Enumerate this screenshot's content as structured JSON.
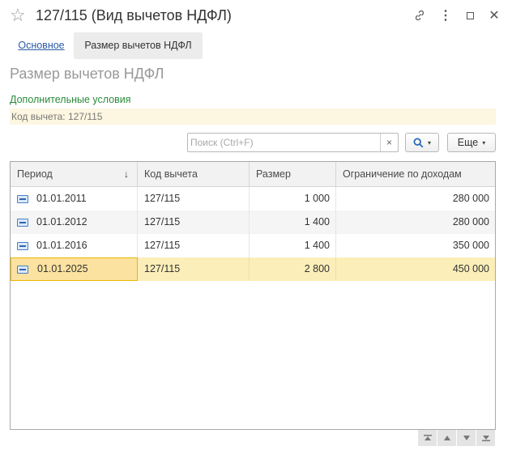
{
  "window": {
    "title": "127/115 (Вид вычетов НДФЛ)",
    "icons": [
      "star-icon",
      "link-icon",
      "more-vert-icon",
      "maximize-icon",
      "close-icon"
    ],
    "close_glyph": "✕",
    "more_glyph": "⋮"
  },
  "tabs": [
    {
      "label": "Основное",
      "active": false
    },
    {
      "label": "Размер вычетов НДФЛ",
      "active": true
    }
  ],
  "page": {
    "title": "Размер вычетов НДФЛ",
    "conditions_link": "Дополнительные условия",
    "filter_text": "Код вычета: 127/115"
  },
  "search": {
    "placeholder": "Поиск (Ctrl+F)",
    "value": "",
    "clear": "×"
  },
  "toolbar": {
    "more_label": "Еще",
    "caret": "▾"
  },
  "table": {
    "columns": [
      "Период",
      "Код вычета",
      "Размер",
      "Ограничение по доходам"
    ],
    "sort_indicator": "↓",
    "rows": [
      {
        "period": "01.01.2011",
        "code": "127/115",
        "size": "1 000",
        "limit": "280 000"
      },
      {
        "period": "01.01.2012",
        "code": "127/115",
        "size": "1 400",
        "limit": "280 000"
      },
      {
        "period": "01.01.2016",
        "code": "127/115",
        "size": "1 400",
        "limit": "350 000"
      },
      {
        "period": "01.01.2025",
        "code": "127/115",
        "size": "2 800",
        "limit": "450 000"
      }
    ],
    "selected_row": 3
  },
  "colors": {
    "link": "#2a5aa8",
    "green_link": "#2a8a3a",
    "selected_row": "#fbeeb8",
    "selected_cell_border": "#e8b800",
    "filter_bar": "#fdf6e0"
  }
}
